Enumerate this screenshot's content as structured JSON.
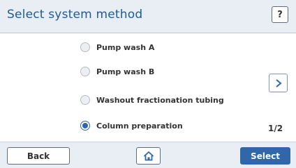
{
  "header": {
    "title": "Select system method",
    "help_label": "?"
  },
  "options": [
    {
      "label": "Pump wash A",
      "selected": false
    },
    {
      "label": "Pump wash B",
      "selected": false
    },
    {
      "label": "Washout fractionation tubing",
      "selected": false
    },
    {
      "label": "Column preparation",
      "selected": true
    }
  ],
  "pagination": {
    "indicator": "1/2",
    "next_icon": "chevron-right-icon"
  },
  "footer": {
    "back_label": "Back",
    "home_icon": "home-icon",
    "select_label": "Select"
  },
  "colors": {
    "accent": "#2f67a8",
    "title": "#1f5a99",
    "header_bg": "#e9eef4"
  }
}
